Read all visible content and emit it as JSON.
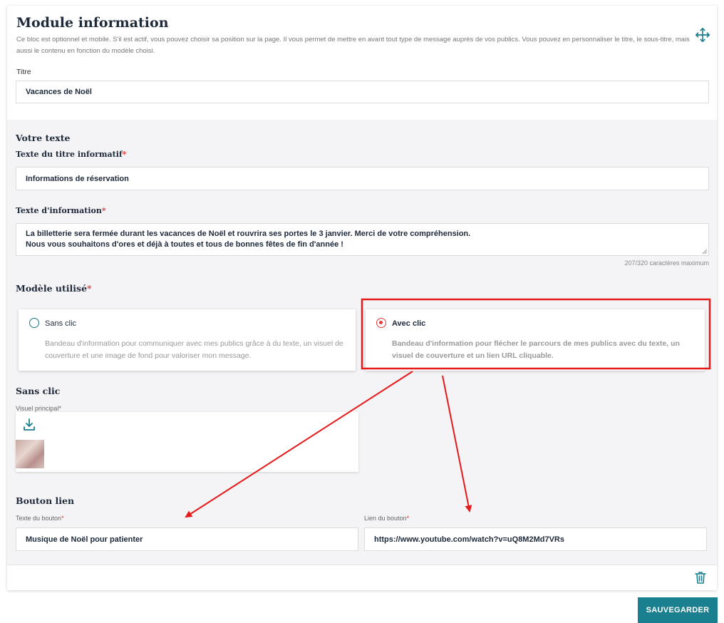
{
  "module": {
    "title": "Module information",
    "description": "Ce bloc est optionnel et mobile. S'il est actif, vous pouvez choisir sa position sur la page. Il vous permet de mettre en avant tout type de message auprès de vos publics. Vous pouvez en personnaliser le titre, le sous-titre, mais aussi le contenu en fonction du modèle choisi.",
    "titre_label": "Titre",
    "titre_value": "Vacances de Noël"
  },
  "texte": {
    "heading": "Votre texte",
    "titre_info_label": "Texte du titre informatif",
    "titre_info_value": "Informations de réservation",
    "info_label": "Texte d'information",
    "info_value": "La billetterie sera fermée durant les vacances de Noël et rouvrira ses portes le 3 janvier. Merci de votre compréhension.\nNous vous souhaitons d'ores et déjà à toutes et tous de bonnes fêtes de fin d'année !",
    "char_count": "207/320 caractères maximum",
    "required_mark": "*"
  },
  "modele": {
    "heading": "Modèle utilisé",
    "options": [
      {
        "title": "Sans clic",
        "description": "Bandeau d'information pour communiquer avec mes publics grâce à du texte, un visuel de couverture et une image de fond pour valoriser mon message.",
        "selected": false
      },
      {
        "title": "Avec clic",
        "description": "Bandeau d'information pour flécher le parcours de mes publics avec du texte, un visuel de couverture et un lien URL cliquable.",
        "selected": true
      }
    ]
  },
  "sans_clic": {
    "heading": "Sans clic",
    "visuel_label": "Visuel principal*"
  },
  "bouton": {
    "heading": "Bouton lien",
    "texte_label": "Texte du bouton",
    "texte_value": "Musique de Noël pour patienter",
    "lien_label": "Lien du bouton",
    "lien_value": "https://www.youtube.com/watch?v=uQ8M2Md7VRs"
  },
  "actions": {
    "save_label": "SAUVEGARDER"
  },
  "colors": {
    "accent": "#1a7f8e",
    "required": "#e23c3c",
    "annotation": "#e51a1a"
  },
  "icons": [
    "move-icon",
    "upload-icon",
    "trash-icon"
  ]
}
